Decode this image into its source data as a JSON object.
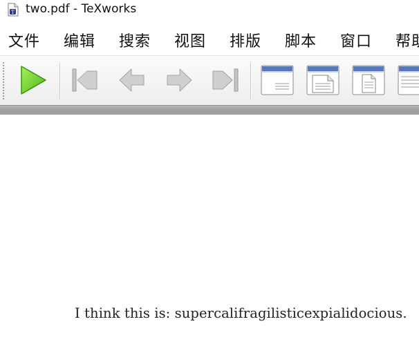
{
  "window": {
    "title": "two.pdf - TeXworks"
  },
  "menubar": {
    "items": [
      {
        "id": "file",
        "label": "文件"
      },
      {
        "id": "edit",
        "label": "编辑"
      },
      {
        "id": "search",
        "label": "搜索"
      },
      {
        "id": "view",
        "label": "视图"
      },
      {
        "id": "typeset",
        "label": "排版"
      },
      {
        "id": "script",
        "label": "脚本"
      },
      {
        "id": "window",
        "label": "窗口"
      },
      {
        "id": "help",
        "label": "帮助"
      }
    ]
  },
  "toolbar": {
    "buttons": [
      {
        "name": "typeset-icon",
        "color": "#6ecf2c"
      },
      {
        "name": "first-page-icon"
      },
      {
        "name": "previous-page-icon"
      },
      {
        "name": "next-page-icon"
      },
      {
        "name": "last-page-icon"
      },
      {
        "name": "actual-size-icon"
      },
      {
        "name": "fit-width-icon"
      },
      {
        "name": "fit-page-icon"
      },
      {
        "name": "continuous-scroll-icon"
      }
    ]
  },
  "document": {
    "text": "I think this is: supercalifragilisticexpialidocious."
  }
}
